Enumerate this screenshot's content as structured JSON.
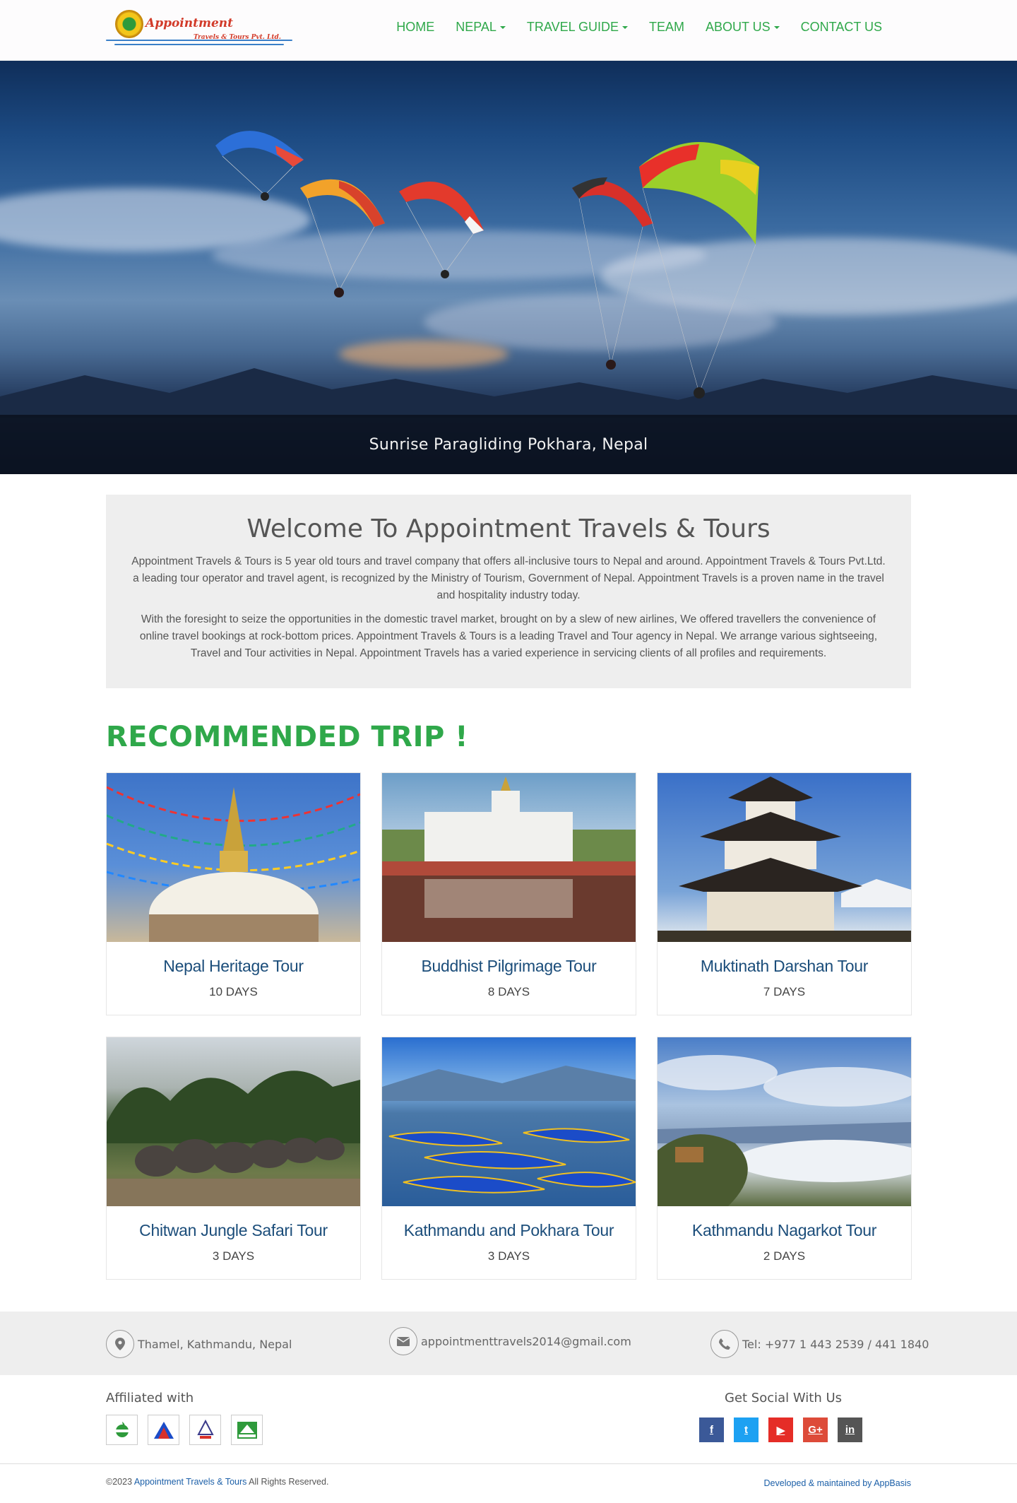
{
  "brand": {
    "name": "Appointment",
    "subname": "Travels & Tours Pvt. Ltd."
  },
  "nav": {
    "items": [
      {
        "label": "HOME",
        "dropdown": false
      },
      {
        "label": "NEPAL",
        "dropdown": true
      },
      {
        "label": "TRAVEL GUIDE",
        "dropdown": true
      },
      {
        "label": "TEAM",
        "dropdown": false
      },
      {
        "label": "ABOUT US",
        "dropdown": true
      },
      {
        "label": "CONTACT US",
        "dropdown": false
      }
    ]
  },
  "hero": {
    "caption": "Sunrise Paragliding Pokhara, Nepal"
  },
  "welcome": {
    "title": "Welcome To Appointment Travels & Tours",
    "para1": "Appointment Travels & Tours is 5 year old tours and travel company that offers all-inclusive tours to Nepal and around. Appointment Travels & Tours Pvt.Ltd. a leading tour operator and travel agent, is recognized by the Ministry of Tourism, Government of Nepal. Appointment Travels is a proven name in the travel and hospitality industry today.",
    "para2": "With the foresight to seize the opportunities in the domestic travel market, brought on by a slew of new airlines, We offered travellers the convenience of online travel bookings at rock-bottom prices.  Appointment Travels & Tours is a leading Travel and Tour agency in Nepal. We arrange various sightseeing, Travel and Tour activities in Nepal. Appointment Travels has a varied experience in servicing clients of all profiles and requirements."
  },
  "recommended": {
    "title": "RECOMMENDED TRIP !",
    "trips": [
      {
        "title": "Nepal Heritage Tour",
        "days": "10 DAYS"
      },
      {
        "title": "Buddhist Pilgrimage Tour",
        "days": "8 DAYS"
      },
      {
        "title": "Muktinath Darshan Tour",
        "days": "7 DAYS"
      },
      {
        "title": "Chitwan Jungle Safari Tour",
        "days": "3 DAYS"
      },
      {
        "title": "Kathmandu and Pokhara Tour",
        "days": "3 DAYS"
      },
      {
        "title": "Kathmandu Nagarkot Tour",
        "days": "2 DAYS"
      }
    ]
  },
  "contact": {
    "address": "Thamel, Kathmandu, Nepal",
    "email": "appointmenttravels2014@gmail.com",
    "phone": "Tel: +977 1 443 2539 / 441 1840"
  },
  "footer": {
    "affiliated_title": "Affiliated with",
    "social_title": "Get Social With Us",
    "social": [
      {
        "icon": "facebook-icon",
        "glyph": "f",
        "color": "#3b5998"
      },
      {
        "icon": "twitter-icon",
        "glyph": "t",
        "color": "#1da1f2"
      },
      {
        "icon": "youtube-icon",
        "glyph": "▶",
        "color": "#e52d27"
      },
      {
        "icon": "google-plus-icon",
        "glyph": "G+",
        "color": "#dd4b39"
      },
      {
        "icon": "linkedin-icon",
        "glyph": "in",
        "color": "#555555"
      }
    ],
    "copyright_prefix": "©2023 ",
    "copyright_link": "Appointment Travels & Tours",
    "copyright_suffix": " All Rights Reserved.",
    "developer": "Developed & maintained by AppBasis"
  },
  "colors": {
    "accent_green": "#2fa84a",
    "title_blue": "#1b4d7a"
  }
}
